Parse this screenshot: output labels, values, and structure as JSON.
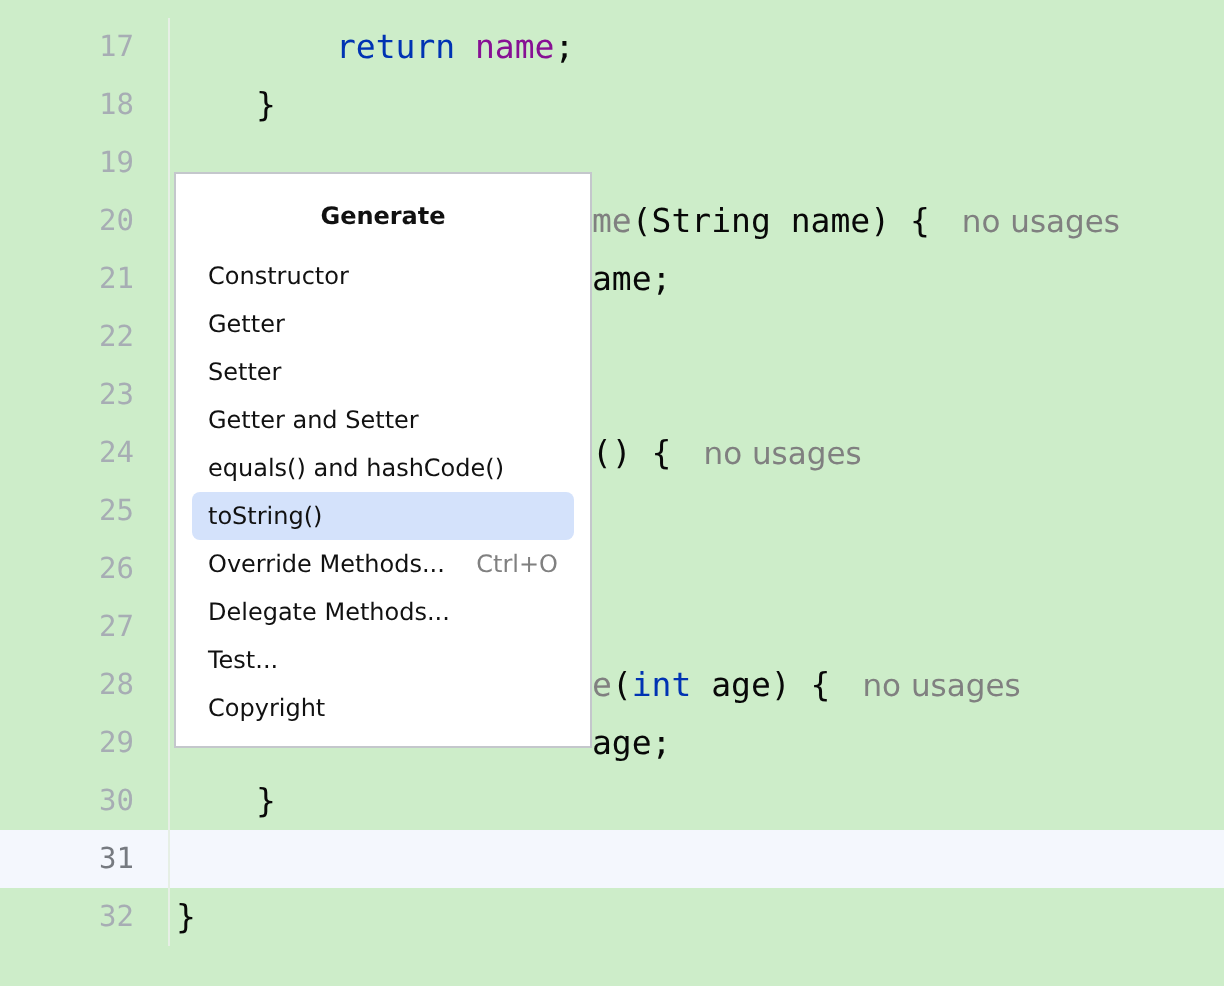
{
  "editor": {
    "lines": [
      {
        "number": "17",
        "current": false,
        "kind": "statement",
        "tokens": [
          {
            "text": "return",
            "kind": "keyword"
          },
          {
            "text": "name",
            "kind": "field",
            "spaced": true
          },
          {
            "text": ";",
            "kind": "plain"
          }
        ]
      },
      {
        "number": "18",
        "current": false,
        "kind": "member",
        "tokens": [
          {
            "text": "}",
            "kind": "plain"
          }
        ]
      },
      {
        "number": "19",
        "current": false,
        "kind": "blank"
      },
      {
        "number": "20",
        "current": false,
        "kind": "covered",
        "tokens": [
          {
            "text": "me",
            "kind": "unused"
          },
          {
            "text": "(String name) {",
            "kind": "plain"
          },
          {
            "text": "no usages",
            "kind": "hint"
          }
        ]
      },
      {
        "number": "21",
        "current": false,
        "kind": "covered",
        "tokens": [
          {
            "text": "ame;",
            "kind": "plain"
          }
        ]
      },
      {
        "number": "22",
        "current": false,
        "kind": "blank"
      },
      {
        "number": "23",
        "current": false,
        "kind": "blank"
      },
      {
        "number": "24",
        "current": false,
        "kind": "covered",
        "tokens": [
          {
            "text": "() {",
            "kind": "plain"
          },
          {
            "text": "no usages",
            "kind": "hint"
          }
        ]
      },
      {
        "number": "25",
        "current": false,
        "kind": "blank"
      },
      {
        "number": "26",
        "current": false,
        "kind": "blank"
      },
      {
        "number": "27",
        "current": false,
        "kind": "blank"
      },
      {
        "number": "28",
        "current": false,
        "kind": "covered",
        "tokens": [
          {
            "text": "e",
            "kind": "unused"
          },
          {
            "text": "(",
            "kind": "plain"
          },
          {
            "text": "int",
            "kind": "keyword"
          },
          {
            "text": " age) {",
            "kind": "plain"
          },
          {
            "text": "no usages",
            "kind": "hint"
          }
        ]
      },
      {
        "number": "29",
        "current": false,
        "kind": "covered",
        "tokens": [
          {
            "text": "age;",
            "kind": "plain"
          }
        ]
      },
      {
        "number": "30",
        "current": false,
        "kind": "member",
        "tokens": [
          {
            "text": "}",
            "kind": "plain"
          }
        ]
      },
      {
        "number": "31",
        "current": true,
        "kind": "blank"
      },
      {
        "number": "32",
        "current": false,
        "kind": "class",
        "tokens": [
          {
            "text": "}",
            "kind": "plain"
          }
        ]
      }
    ]
  },
  "popup": {
    "title": "Generate",
    "items": [
      {
        "label": "Constructor",
        "selected": false
      },
      {
        "label": "Getter",
        "selected": false
      },
      {
        "label": "Setter",
        "selected": false
      },
      {
        "label": "Getter and Setter",
        "selected": false
      },
      {
        "label": "equals() and hashCode()",
        "selected": false
      },
      {
        "label": "toString()",
        "selected": true
      },
      {
        "label": "Override Methods...",
        "shortcut": "Ctrl+O",
        "selected": false
      },
      {
        "label": "Delegate Methods...",
        "selected": false
      },
      {
        "label": "Test...",
        "selected": false
      },
      {
        "label": "Copyright",
        "selected": false
      }
    ]
  }
}
